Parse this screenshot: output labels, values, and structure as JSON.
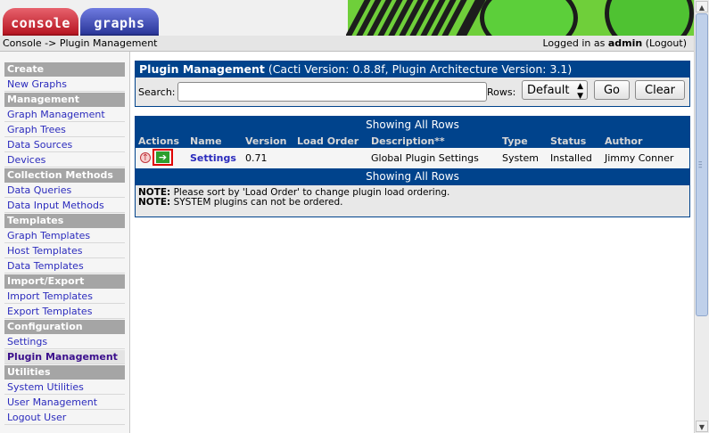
{
  "tabs": [
    {
      "label": "console"
    },
    {
      "label": "graphs"
    }
  ],
  "breadcrumb": {
    "root": "Console",
    "separator": "->",
    "current": "Plugin Management"
  },
  "login": {
    "prefix": "Logged in as",
    "user": "admin",
    "logout_open": "(",
    "logout": "Logout",
    "logout_close": ")"
  },
  "sidebar": {
    "sections": [
      {
        "header": "Create",
        "items": [
          "New Graphs"
        ]
      },
      {
        "header": "Management",
        "items": [
          "Graph Management",
          "Graph Trees",
          "Data Sources",
          "Devices"
        ]
      },
      {
        "header": "Collection Methods",
        "items": [
          "Data Queries",
          "Data Input Methods"
        ]
      },
      {
        "header": "Templates",
        "items": [
          "Graph Templates",
          "Host Templates",
          "Data Templates"
        ]
      },
      {
        "header": "Import/Export",
        "items": [
          "Import Templates",
          "Export Templates"
        ]
      },
      {
        "header": "Configuration",
        "items": [
          "Settings",
          "Plugin Management"
        ]
      },
      {
        "header": "Utilities",
        "items": [
          "System Utilities",
          "User Management",
          "Logout User"
        ]
      }
    ],
    "active_item": "Plugin Management"
  },
  "filter_panel": {
    "title_bold": "Plugin Management",
    "title_rest": " (Cacti Version: 0.8.8f, Plugin Architecture Version: 3.1)",
    "search_label": "Search:",
    "search_value": "",
    "rows_label": "Rows:",
    "rows_value": "Default",
    "go_label": "Go",
    "clear_label": "Clear"
  },
  "plugin_table": {
    "nav_text_top": "Showing All Rows",
    "nav_text_bottom": "Showing All Rows",
    "headers": {
      "actions": "Actions",
      "name": "Name",
      "version": "Version",
      "load_order": "Load Order",
      "description": "Description**",
      "type": "Type",
      "status": "Status",
      "author": "Author"
    },
    "rows": [
      {
        "name": "Settings",
        "version": "0.71",
        "load_order": "",
        "description": "Global Plugin Settings",
        "type": "System",
        "status": "Installed",
        "author": "Jimmy Conner"
      }
    ],
    "notes": [
      {
        "label": "NOTE:",
        "text": " Please sort by 'Load Order' to change plugin load ordering."
      },
      {
        "label": "NOTE:",
        "text": " SYSTEM plugins can not be ordered."
      }
    ]
  },
  "icons": {
    "uninstall": "uninstall-icon",
    "disable": "disable-arrow-icon"
  },
  "colors": {
    "header_blue": "#00438c",
    "console_tab": "#c41c28",
    "graphs_tab": "#3a46b0",
    "highlight_red": "#e00000"
  }
}
